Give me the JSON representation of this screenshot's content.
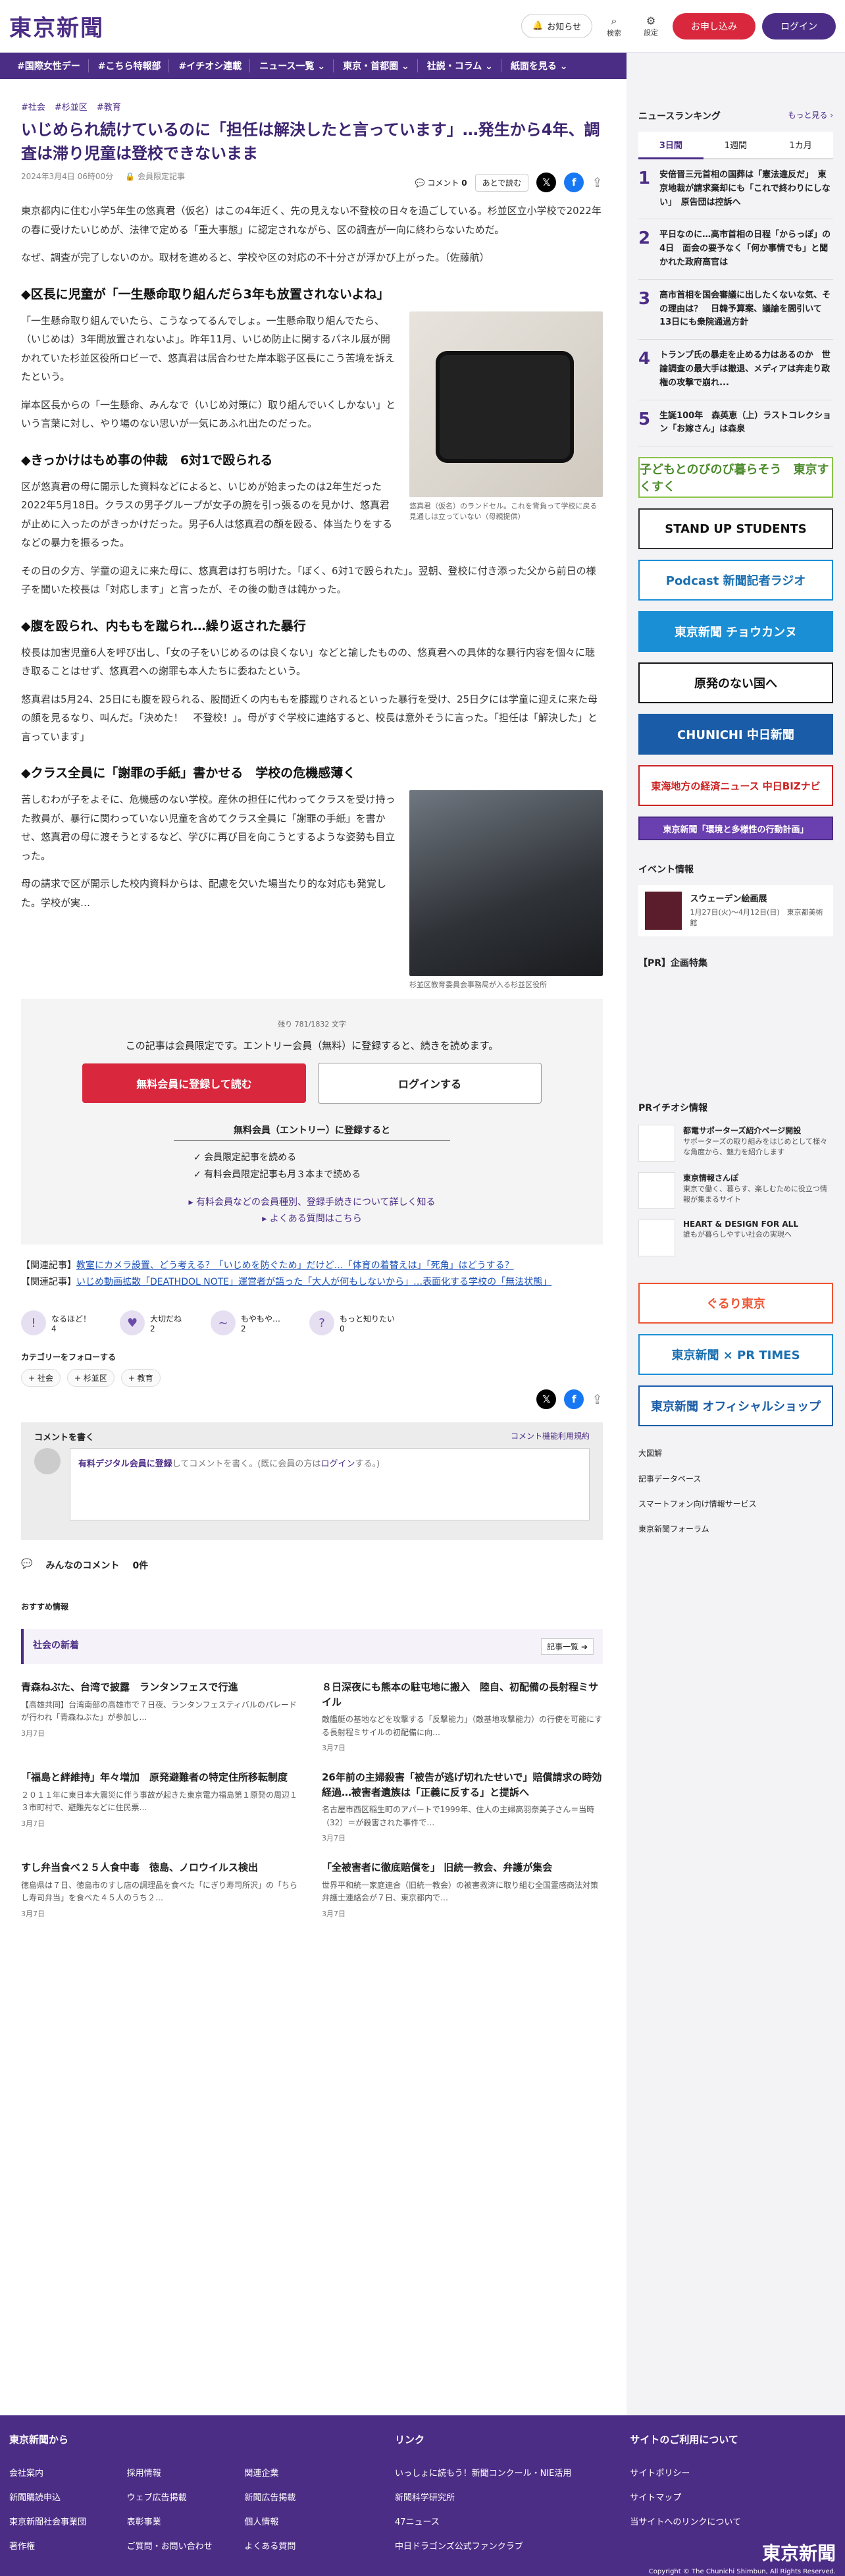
{
  "header": {
    "logo": "東京新聞",
    "notify": "お知らせ",
    "search": "検索",
    "settings": "設定",
    "register": "お申し込み",
    "login": "ログイン"
  },
  "nav": [
    "#国際女性デー",
    "#こちら特報部",
    "#イチオシ連載",
    "ニュース一覧 ⌄",
    "東京・首都圏 ⌄",
    "社説・コラム ⌄",
    "紙面を見る ⌄"
  ],
  "article": {
    "tags": [
      "#社会",
      "#杉並区",
      "#教育"
    ],
    "title": "いじめられ続けているのに「担任は解決したと言っています」…発生から4年、調査は滞り児童は登校できないまま",
    "date": "2024年3月4日 06時00分",
    "member": "会員限定記事",
    "comment_label": "コメント",
    "comment_count": "0",
    "read_later": "あとで読む",
    "p1": "東京都内に住む小学5年生の悠真君（仮名）はこの4年近く、先の見えない不登校の日々を過ごしている。杉並区立小学校で2022年の春に受けたいじめが、法律で定める「重大事態」に認定されながら、区の調査が一向に終わらないためだ。",
    "p2": "なぜ、調査が完了しないのか。取材を進めると、学校や区の対応の不十分さが浮かび上がった。（佐藤航）",
    "h1": "◆区長に児童が「一生懸命取り組んだら3年も放置されないよね」",
    "p3": "「一生懸命取り組んでいたら、こうなってるんでしょ。一生懸命取り組んでたら、（いじめは）3年間放置されないよ」。昨年11月、いじめ防止に関するパネル展が開かれていた杉並区役所ロビーで、悠真君は居合わせた岸本聡子区長にこう苦境を訴えたという。",
    "p4": "岸本区長からの「一生懸命、みんなで（いじめ対策に）取り組んでいくしかない」という言葉に対し、やり場のない思いが一気にあふれ出たのだった。",
    "cap1": "悠真君（仮名）のランドセル。これを背負って学校に戻る見通しは立っていない（母親提供）",
    "h2": "◆きっかけはもめ事の仲裁　6対1で殴られる",
    "p5": "区が悠真君の母に開示した資料などによると、いじめが始まったのは2年生だった2022年5月18日。クラスの男子グループが女子の腕を引っ張るのを見かけ、悠真君が止めに入ったのがきっかけだった。男子6人は悠真君の顔を殴る、体当たりをするなどの暴力を振るった。",
    "p6": "その日の夕方、学童の迎えに来た母に、悠真君は打ち明けた。「ぼく、6対1で殴られた」。翌朝、登校に付き添った父から前日の様子を聞いた校長は「対応します」と言ったが、その後の動きは鈍かった。",
    "h3": "◆腹を殴られ、内ももを蹴られ…繰り返された暴行",
    "p7": "校長は加害児童6人を呼び出し、「女の子をいじめるのは良くない」などと諭したものの、悠真君への具体的な暴行内容を個々に聴き取ることはせず、悠真君への謝罪も本人たちに委ねたという。",
    "p8": "悠真君は5月24、25日にも腹を殴られる、股間近くの内ももを膝蹴りされるといった暴行を受け、25日夕には学童に迎えに来た母の顔を見るなり、叫んだ。「決めた！　不登校！」。母がすぐ学校に連絡すると、校長は意外そうに言った。「担任は「解決した」と言っています」",
    "h4": "◆クラス全員に「謝罪の手紙」書かせる　学校の危機感薄く",
    "p9": "苦しむわが子をよそに、危機感のない学校。産休の担任に代わってクラスを受け持った教員が、暴行に関わっていない児童を含めてクラス全員に「謝罪の手紙」を書かせ、悠真君の母に渡そうとするなど、学びに再び目を向こうとするような姿勢も目立った。",
    "p10": "母の請求で区が開示した校内資料からは、配慮を欠いた場当たり的な対応も発覚した。学校が実…",
    "cap2": "杉並区教育委員会事務局が入る杉並区役所"
  },
  "paywall": {
    "remain": "残り 781/1832 文字",
    "msg": "この記事は会員限定です。エントリー会員（無料）に登録すると、続きを読めます。",
    "reg": "無料会員に登録して読む",
    "login": "ログインする",
    "entry_title": "無料会員（エントリー）に登録すると",
    "b1": "✓ 会員限定記事を読める",
    "b2": "✓ 有料会員限定記事も月３本まで読める",
    "l1": "▸ 有料会員などの会員種別、登録手続きについて詳しく知る",
    "l2": "▸ よくある質問はこちら"
  },
  "related": [
    {
      "label": "【関連記事】",
      "text": "教室にカメラ設置、どう考える？「いじめを防ぐため」だけど…「体育の着替えは」「死角」はどうする？"
    },
    {
      "label": "【関連記事】",
      "text": "いじめ動画拡散「DEATHDOL NOTE」運営者が語った「大人が何もしないから」…表面化する学校の「無法状態」"
    }
  ],
  "reactions": [
    {
      "l": "なるほど！",
      "c": "4"
    },
    {
      "l": "大切だね",
      "c": "2"
    },
    {
      "l": "もやもや…",
      "c": "2"
    },
    {
      "l": "もっと知りたい",
      "c": "0"
    }
  ],
  "follow": {
    "title": "カテゴリーをフォローする",
    "chips": [
      "+ 社会",
      "+ 杉並区",
      "+ 教育"
    ]
  },
  "comments": {
    "write": "コメントを書く",
    "terms": "コメント機能利用規約",
    "paid": "有料デジタル会員に登録",
    "mid": "してコメントを書く。(既に会員の方は",
    "login": "ログイン",
    "end": "する。)",
    "all": "みんなのコメント",
    "count": "0件"
  },
  "recommend": "おすすめ情報",
  "society": {
    "title": "社会の新着",
    "more": "記事一覧 ➔",
    "items": [
      {
        "t": "青森ねぶた、台湾で披露　ランタンフェスで行進",
        "b": "【高雄共同】台湾南部の高雄市で７日夜、ランタンフェスティバルのパレードが行われ「青森ねぶた」が参加し…",
        "d": "3月7日"
      },
      {
        "t": "８日深夜にも熊本の駐屯地に搬入　陸自、初配備の長射程ミサイル",
        "b": "敵艦艇の基地などを攻撃する「反撃能力」（敵基地攻撃能力）の行使を可能にする長射程ミサイルの初配備に向…",
        "d": "3月7日"
      },
      {
        "t": "「福島と絆維持」年々増加　原発避難者の特定住所移転制度",
        "b": "２０１１年に東日本大震災に伴う事故が起きた東京電力福島第１原発の周辺１３市町村で、避難先などに住民票…",
        "d": "3月7日"
      },
      {
        "t": "26年前の主婦殺害「被告が逃げ切れたせいで」賠償請求の時効経過…被害者遺族は「正義に反する」と提訴へ",
        "b": "名古屋市西区稲生町のアパートで1999年、住人の主婦高羽奈美子さん＝当時（32）＝が殺害された事件で…",
        "d": "3月7日"
      },
      {
        "t": "すし弁当食べ２５人食中毒　徳島、ノロウイルス検出",
        "b": "徳島県は７日、徳島市のすし店の調理品を食べた「にぎり寿司所沢」の「ちらし寿司弁当」を食べた４５人のうち２…",
        "d": "3月7日"
      },
      {
        "t": "「全被害者に徹底賠償を」 旧統一教会、弁護が集会",
        "b": "世界平和統一家庭連合（旧統一教会）の被害救済に取り組む全国霊感商法対策弁護士連絡会が７日、東京都内で…",
        "d": "3月7日"
      }
    ]
  },
  "sidebar": {
    "ranking_title": "ニュースランキング",
    "more": "もっと見る ›",
    "tabs": [
      "3日間",
      "1週間",
      "1カ月"
    ],
    "items": [
      {
        "n": "1",
        "t": "安倍晋三元首相の国葬は「憲法違反だ」　東京地裁が請求棄却にも「これで終わりにしない」　原告団は控訴へ"
      },
      {
        "n": "2",
        "t": "平日なのに…高市首相の日程「からっぽ」の4日　面会の要予なく「何か事情でも」と聞かれた政府高官は"
      },
      {
        "n": "3",
        "t": "高市首相を国会審議に出したくないな気、その理由は？　日韓予算案、議論を間引いて13日にも衆院通過方針"
      },
      {
        "n": "4",
        "t": "トランプ氏の暴走を止める力はあるのか　世論調査の最大手は撤退、メディアは奔走り政権の攻撃で崩れ..."
      },
      {
        "n": "5",
        "t": "生誕100年　森英恵（上）ラストコレクション「お嫁さん」は森泉"
      }
    ],
    "banners": [
      "子どもとのびのび暮らそう　東京すくすく",
      "STAND UP STUDENTS",
      "Podcast 新聞記者ラジオ",
      "東京新聞 チョウカンヌ",
      "原発のない国へ",
      "CHUNICHI 中日新聞",
      "東海地方の経済ニュース 中日BIZナビ",
      "東京新聞「環境と多様性の行動計画」"
    ],
    "events_title": "イベント情報",
    "event": {
      "t": "スウェーデン絵画展",
      "d": "1月27日(火)～4月12日(日)　東京都美術館"
    },
    "pr_title": "【PR】企画特集",
    "pr2_title": "PRイチオシ情報",
    "pr_items": [
      {
        "t": "都電サポーターズ紹介ページ開設",
        "b": "サポーターズの取り組みをはじめとして様々な角度から、魅力を紹介します"
      },
      {
        "t": "東京情報さんぽ",
        "b": "東京で働く、暮らす、楽しむために役立つ情報が集まるサイト"
      },
      {
        "t": "HEART & DESIGN FOR ALL",
        "b": "誰もが暮らしやすい社会の実現へ"
      }
    ],
    "shop_banners": [
      "ぐるり東京",
      "東京新聞 × PR TIMES",
      "東京新聞 オフィシャルショップ"
    ],
    "links": [
      "大図解",
      "記事データベース",
      "スマートフォン向け情報サービス",
      "東京新聞フォーラム"
    ]
  },
  "footer": {
    "c1": "東京新聞から",
    "c1a": [
      "会社案内",
      "新聞購読申込",
      "東京新聞社会事業団",
      "著作権"
    ],
    "c1b": [
      "採用情報",
      "ウェブ広告掲載",
      "表彰事業",
      "ご質問・お問い合わせ"
    ],
    "c1c": [
      "関連企業",
      "新聞広告掲載",
      "個人情報",
      "よくある質問"
    ],
    "c2": "リンク",
    "c2a": [
      "いっしょに読もう！新聞コンクール・NIE活用",
      "新聞科学研究所",
      "47ニュース",
      "中日ドラゴンズ公式ファンクラブ"
    ],
    "c3": "サイトのご利用について",
    "c3a": [
      "サイトポリシー",
      "サイトマップ",
      "当サイトへのリンクについて"
    ],
    "logo": "東京新聞",
    "copy": "Copyright © The Chunichi Shimbun, All Rights Reserved."
  }
}
